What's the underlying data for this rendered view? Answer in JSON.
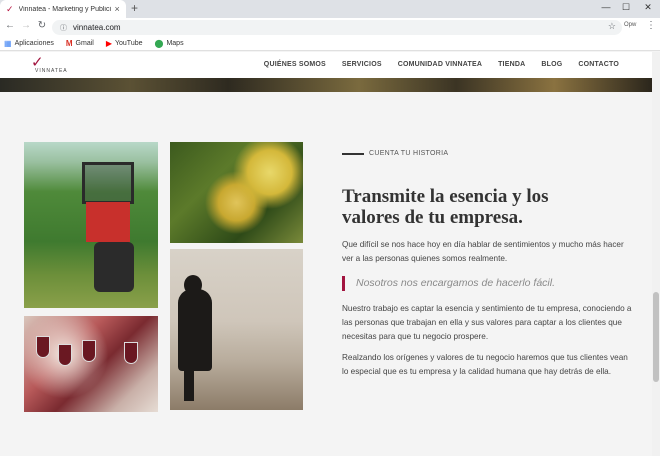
{
  "browser": {
    "tab_title": "Vinnatea - Marketing y Publicidad",
    "tab_close": "×",
    "new_tab": "+",
    "url": "vinnatea.com",
    "window_controls": [
      "—",
      "☐",
      "✕"
    ],
    "profile_label": "Opw",
    "bookmarks": [
      {
        "icon": "apps-icon",
        "label": "Aplicaciones"
      },
      {
        "icon": "gmail-icon",
        "label": "Gmail"
      },
      {
        "icon": "youtube-icon",
        "label": "YouTube"
      },
      {
        "icon": "maps-icon",
        "label": "Maps"
      }
    ]
  },
  "site": {
    "logo_text": "VINNATEA",
    "brand_color": "#a2143f",
    "nav": [
      "QUIÉNES SOMOS",
      "SERVICIOS",
      "COMUNIDAD VINNATEA",
      "TIENDA",
      "BLOG",
      "CONTACTO"
    ]
  },
  "content": {
    "eyebrow": "CUENTA TU HISTORIA",
    "heading_line1": "Transmite la esencia y los",
    "heading_line2": "valores de tu empresa.",
    "intro": "Que difícil se nos hace hoy en día hablar de sentimientos y mucho más hacer  ver a las personas quienes somos realmente.",
    "quote": "Nosotros nos encargamos de hacerlo fácil.",
    "para2": "Nuestro trabajo es captar la esencia y sentimiento de tu empresa, conociendo a las personas que trabajan en ella y sus valores para captar a los clientes que necesitas para que tu negocio prospere.",
    "para3": "Realzando los orígenes y valores de tu negocio haremos que tus clientes vean lo especial que es tu empresa y la calidad humana que hay detrás de ella."
  }
}
